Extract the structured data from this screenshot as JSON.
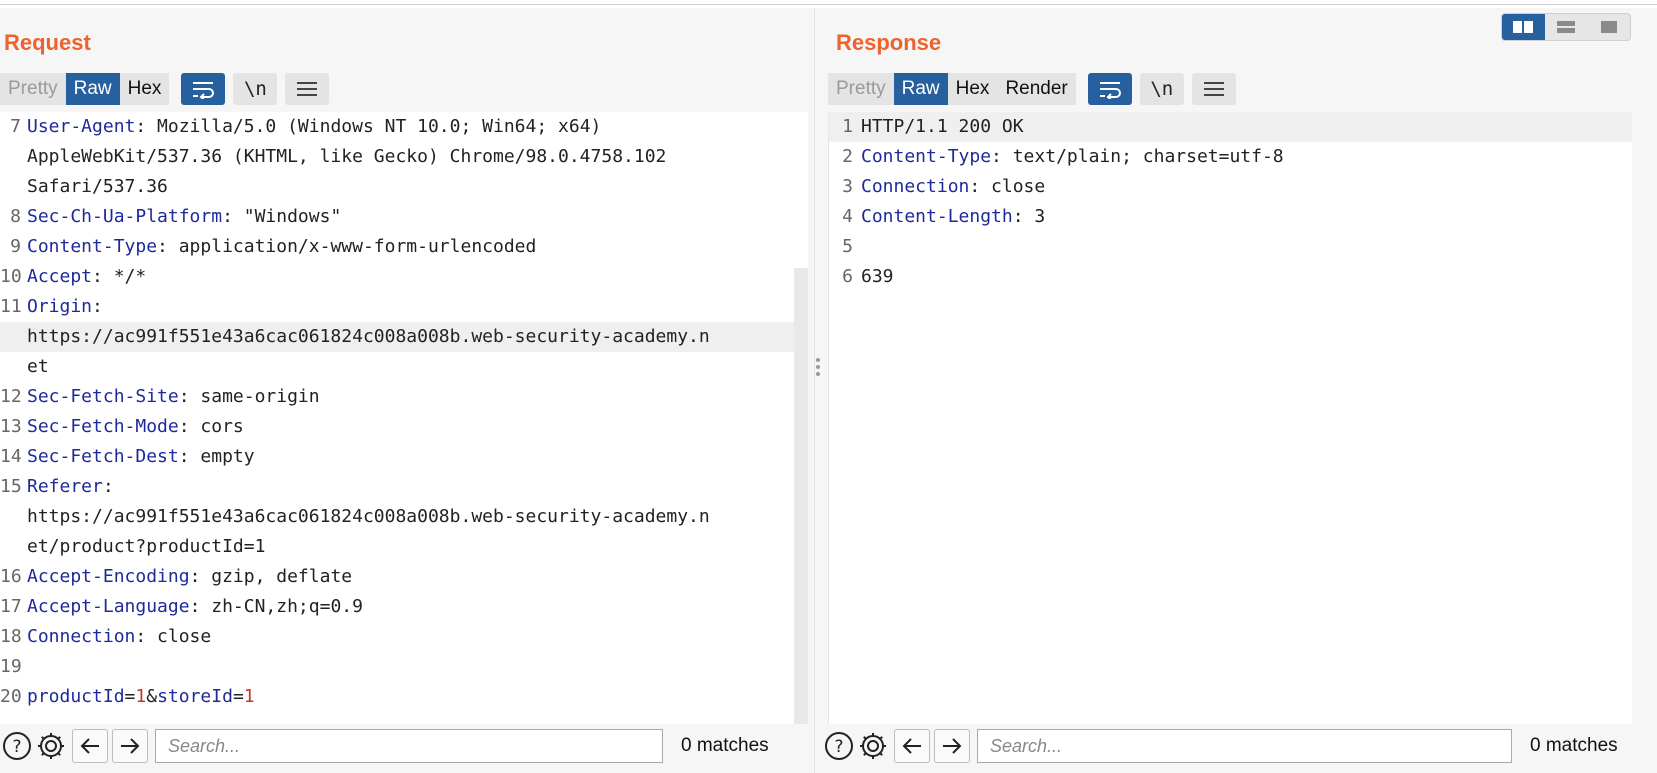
{
  "request": {
    "title": "Request",
    "tabs": [
      {
        "label": "Pretty",
        "state": "disabled"
      },
      {
        "label": "Raw",
        "state": "active"
      },
      {
        "label": "Hex",
        "state": "normal"
      }
    ],
    "newline_label": "\\n",
    "lines": [
      {
        "num": "7",
        "name": "User-Agent",
        "value": ": Mozilla/5.0 (Windows NT 10.0; Win64; x64)"
      },
      {
        "num": "",
        "text": "AppleWebKit/537.36 (KHTML, like Gecko) Chrome/98.0.4758.102"
      },
      {
        "num": "",
        "text": "Safari/537.36"
      },
      {
        "num": "8",
        "name": "Sec-Ch-Ua-Platform",
        "value": ": \"Windows\""
      },
      {
        "num": "9",
        "name": "Content-Type",
        "value": ": application/x-www-form-urlencoded"
      },
      {
        "num": "10",
        "name": "Accept",
        "value": ": */*"
      },
      {
        "num": "11",
        "name": "Origin",
        "value": ":"
      },
      {
        "num": "",
        "text": "https://ac991f551e43a6cac061824c008a008b.web-security-academy.n",
        "highlight": true
      },
      {
        "num": "",
        "text": "et"
      },
      {
        "num": "12",
        "name": "Sec-Fetch-Site",
        "value": ": same-origin"
      },
      {
        "num": "13",
        "name": "Sec-Fetch-Mode",
        "value": ": cors"
      },
      {
        "num": "14",
        "name": "Sec-Fetch-Dest",
        "value": ": empty"
      },
      {
        "num": "15",
        "name": "Referer",
        "value": ":"
      },
      {
        "num": "",
        "text": "https://ac991f551e43a6cac061824c008a008b.web-security-academy.n"
      },
      {
        "num": "",
        "text": "et/product?productId=1"
      },
      {
        "num": "16",
        "name": "Accept-Encoding",
        "value": ": gzip, deflate"
      },
      {
        "num": "17",
        "name": "Accept-Language",
        "value": ": zh-CN,zh;q=0.9"
      },
      {
        "num": "18",
        "name": "Connection",
        "value": ": close"
      },
      {
        "num": "19",
        "text": ""
      },
      {
        "num": "20",
        "params": [
          {
            "name": "productId",
            "value": "1"
          },
          {
            "name": "storeId",
            "value": "1"
          }
        ]
      }
    ],
    "search": {
      "placeholder": "Search...",
      "matches": "0 matches"
    }
  },
  "response": {
    "title": "Response",
    "tabs": [
      {
        "label": "Pretty",
        "state": "disabled"
      },
      {
        "label": "Raw",
        "state": "active"
      },
      {
        "label": "Hex",
        "state": "normal"
      },
      {
        "label": "Render",
        "state": "normal"
      }
    ],
    "newline_label": "\\n",
    "lines": [
      {
        "num": "1",
        "text": "HTTP/1.1 200 OK",
        "highlight": true
      },
      {
        "num": "2",
        "name": "Content-Type",
        "value": ": text/plain; charset=utf-8"
      },
      {
        "num": "3",
        "name": "Connection",
        "value": ": close"
      },
      {
        "num": "4",
        "name": "Content-Length",
        "value": ": 3"
      },
      {
        "num": "5",
        "text": ""
      },
      {
        "num": "6",
        "text": "639"
      }
    ],
    "search": {
      "placeholder": "Search...",
      "matches": "0 matches"
    }
  },
  "colors": {
    "accent_title": "#f0622d",
    "active_tab": "#26609e",
    "header_name": "#1d2a9a",
    "param_value": "#c0392b"
  },
  "icons": {
    "wrap": "wrap-lines-icon",
    "newline": "show-newlines-icon",
    "menu": "hamburger-menu-icon",
    "help": "help-icon",
    "settings": "gear-icon",
    "back": "arrow-left-icon",
    "forward": "arrow-right-icon",
    "layout": [
      "layout-side-by-side-icon",
      "layout-stacked-icon",
      "layout-tabs-icon"
    ]
  }
}
